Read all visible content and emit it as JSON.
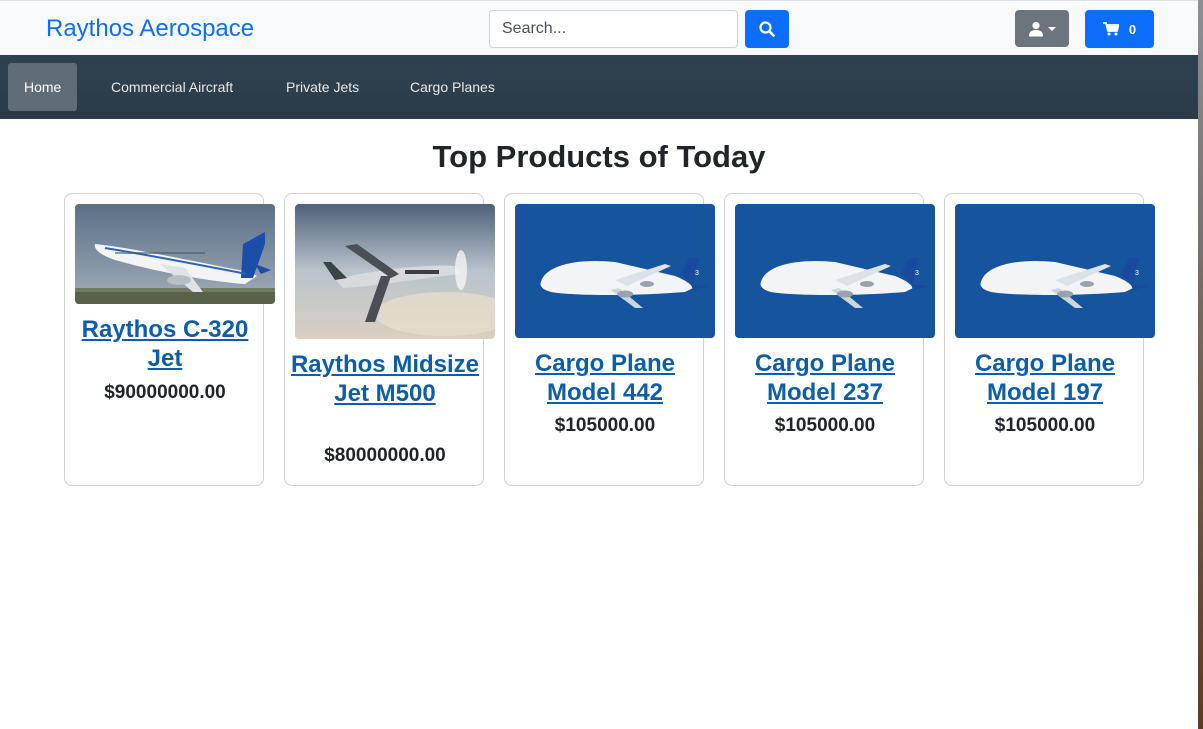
{
  "header": {
    "brand": "Raythos Aerospace",
    "search_placeholder": "Search...",
    "cart_count": "0"
  },
  "nav": {
    "items": [
      {
        "label": "Home",
        "active": true
      },
      {
        "label": "Commercial Aircraft",
        "active": false
      },
      {
        "label": "Private Jets",
        "active": false
      },
      {
        "label": "Cargo Planes",
        "active": false
      }
    ]
  },
  "main": {
    "heading": "Top Products of Today",
    "products": [
      {
        "title": "Raythos C-320 Jet",
        "price": "$90000000.00",
        "image": "commercial-airliner-takeoff"
      },
      {
        "title": "Raythos Midsize Jet M500",
        "price": "$80000000.00",
        "image": "private-turboprop-in-sky"
      },
      {
        "title": "Cargo Plane Model 442",
        "price": "$105000.00",
        "image": "beluga-cargo-plane"
      },
      {
        "title": "Cargo Plane Model 237",
        "price": "$105000.00",
        "image": "beluga-cargo-plane"
      },
      {
        "title": "Cargo Plane Model 197",
        "price": "$105000.00",
        "image": "beluga-cargo-plane"
      }
    ]
  },
  "colors": {
    "brand": "#0d6efd",
    "navbar": "#2f4150",
    "nav_active": "#5f6d79",
    "link": "#0d5ea8",
    "user_button": "#6c757d"
  }
}
